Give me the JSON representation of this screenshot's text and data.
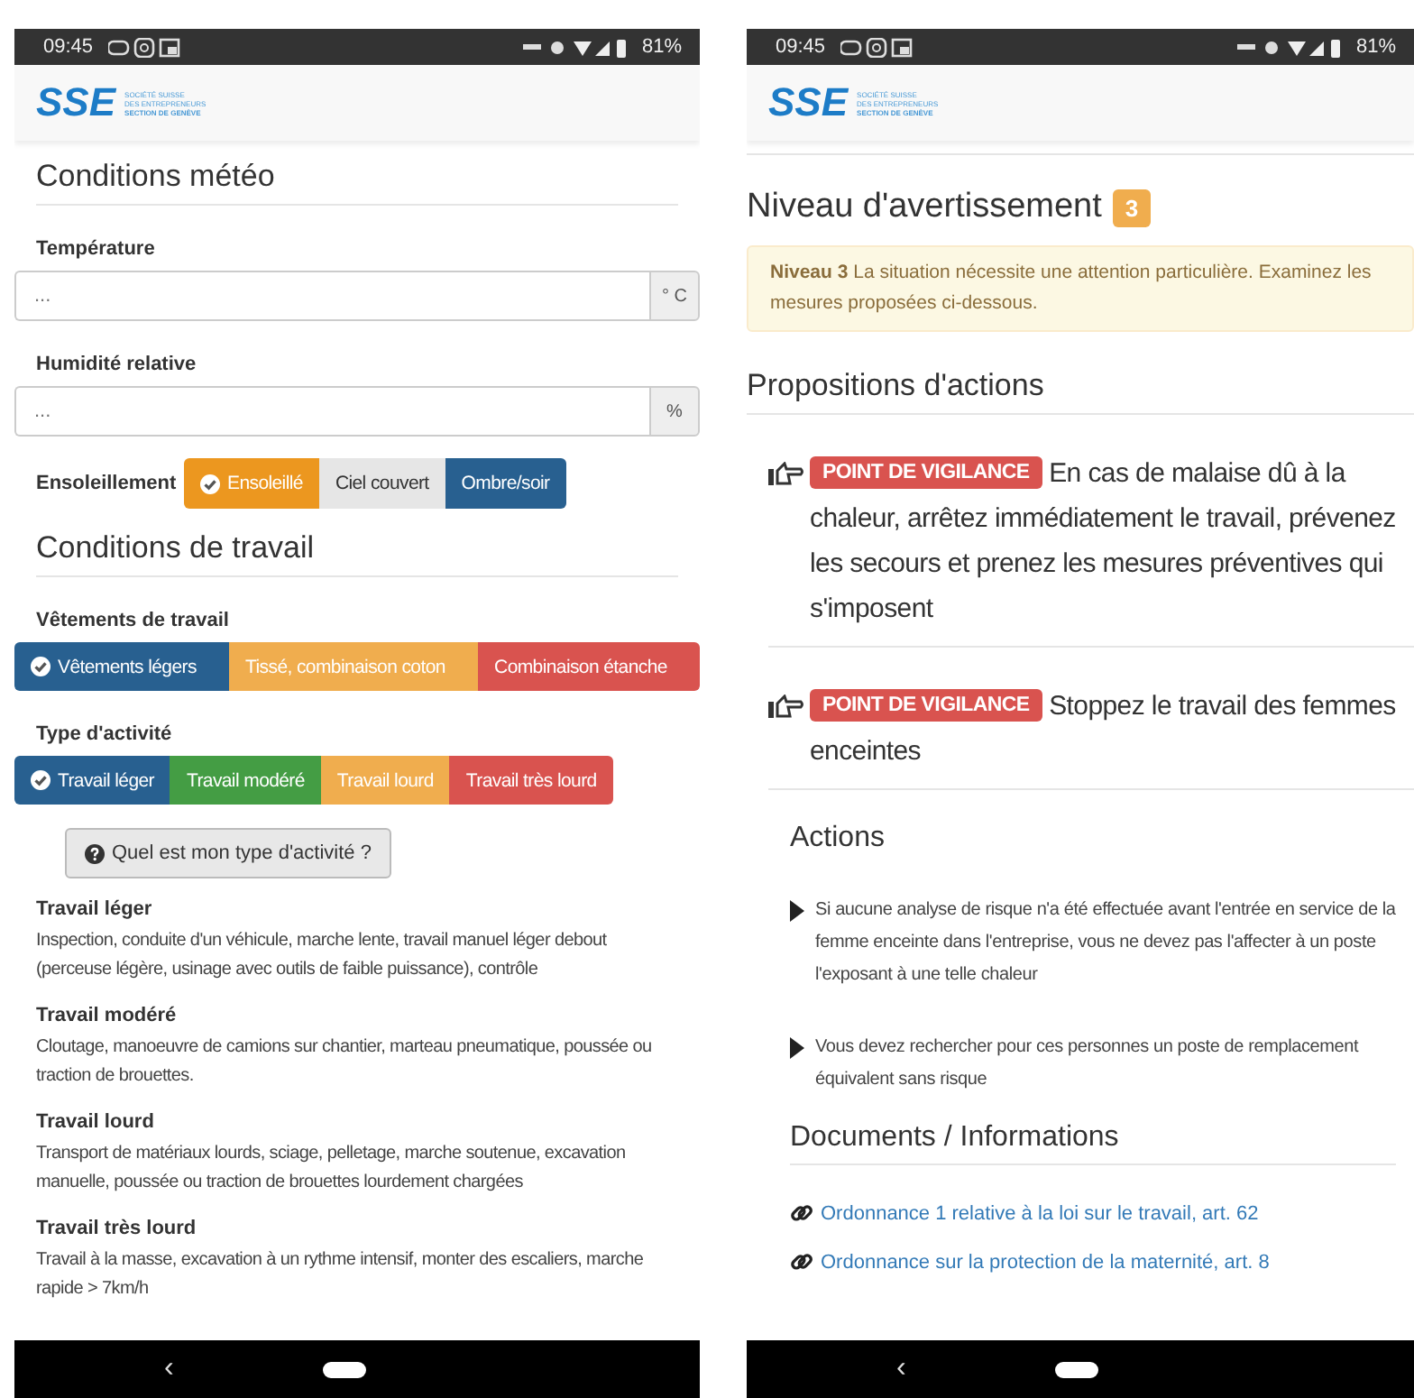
{
  "left_phone": {
    "status_bar": {
      "time": "09:45",
      "battery": "81%"
    },
    "logo": {
      "mark": "SSE",
      "lines": [
        "SOCIÉTÉ SUISSE",
        "DES ENTREPRENEURS",
        "SECTION DE GENÈVE"
      ]
    },
    "weather_section": {
      "title": "Conditions météo",
      "fields": [
        {
          "label": "Température",
          "placeholder": "...",
          "unit": "° C"
        },
        {
          "label": "Humidité relative",
          "placeholder": "...",
          "unit": "%"
        }
      ],
      "sunshine": {
        "label": "Ensoleillement",
        "options": [
          {
            "label": "Ensoleillé",
            "selected": true,
            "color": "#ec971f"
          },
          {
            "label": "Ciel couvert",
            "selected": false,
            "color": "#e6e6e6"
          },
          {
            "label": "Ombre/soir",
            "selected": false,
            "color": "#286090"
          }
        ]
      }
    },
    "work_section": {
      "title": "Conditions de travail",
      "groups": [
        {
          "label": "Vêtements de travail",
          "options": [
            {
              "label": "Vêtements légers",
              "selected": true,
              "color": "#286090"
            },
            {
              "label": "Tissé, combinaison coton",
              "selected": false,
              "color": "#f0ad4e"
            },
            {
              "label": "Combinaison étanche",
              "selected": false,
              "color": "#d9534f"
            }
          ]
        },
        {
          "label": "Type d'activité",
          "options": [
            {
              "label": "Travail léger",
              "selected": true,
              "color": "#286090"
            },
            {
              "label": "Travail modéré",
              "selected": false,
              "color": "#449d44"
            },
            {
              "label": "Travail lourd",
              "selected": false,
              "color": "#f0ad4e"
            },
            {
              "label": "Travail très lourd",
              "selected": false,
              "color": "#d9534f"
            }
          ]
        }
      ],
      "help_button": "Quel est mon type d'activité ?",
      "definitions": [
        {
          "title": "Travail léger",
          "text": "Inspection, conduite d'un véhicule, marche lente, travail manuel léger debout (perceuse légère, usinage avec outils de faible puissance), contrôle"
        },
        {
          "title": "Travail modéré",
          "text": "Cloutage, manoeuvre de camions sur chantier, marteau pneumatique, poussée ou traction de brouettes."
        },
        {
          "title": "Travail lourd",
          "text": "Transport de matériaux lourds, sciage, pelletage, marche soutenue, excavation manuelle, poussée ou traction de brouettes lourdement chargées"
        },
        {
          "title": "Travail très lourd",
          "text": "Travail à la masse, excavation à un rythme intensif, monter des escaliers, marche rapide > 7km/h"
        }
      ]
    },
    "nav_bar": {
      "back": "‹"
    }
  },
  "right_phone": {
    "status_bar": {
      "time": "09:45",
      "battery": "81%"
    },
    "logo": {
      "mark": "SSE",
      "lines": [
        "SOCIÉTÉ SUISSE",
        "DES ENTREPRENEURS",
        "SECTION DE GENÈVE"
      ]
    },
    "warning": {
      "title": "Niveau d'avertissement",
      "level": "3",
      "message": "**Niveau 3** La situation nécessite une attention particulière. Examinez les mesures proposées ci-dessous."
    },
    "proposals": {
      "title": "Propositions d'actions",
      "items": [
        {
          "badge": "POINT DE VIGILANCE",
          "text": "En cas de malaise dû à la chaleur, arrêtez immédiatement le travail, prévenez les secours et prenez les mesures préventives qui s'imposent"
        },
        {
          "badge": "POINT DE VIGILANCE",
          "text": "Stoppez le travail des femmes enceintes"
        }
      ]
    },
    "actions": {
      "title": "Actions",
      "items": [
        "Si aucune analyse de risque n'a été effectuée avant l'entrée en service de la femme enceinte dans l'entreprise, vous ne devez pas l'affecter à un poste l'exposant à une telle chaleur",
        "Vous devez rechercher pour ces personnes un poste de remplacement équivalent sans risque"
      ]
    },
    "documents": {
      "title": "Documents / Informations",
      "links": [
        "Ordonnance 1 relative à la loi sur le travail, art. 62",
        "Ordonnance sur la protection de la maternité, art. 8"
      ]
    },
    "nav_bar": {
      "back": "‹"
    }
  }
}
